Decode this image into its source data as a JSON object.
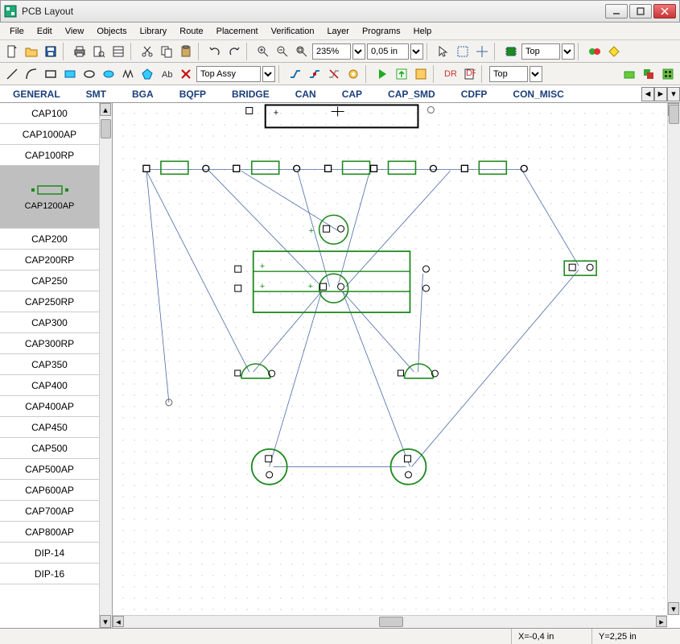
{
  "window": {
    "title": "PCB Layout"
  },
  "menu": [
    "File",
    "Edit",
    "View",
    "Objects",
    "Library",
    "Route",
    "Placement",
    "Verification",
    "Layer",
    "Programs",
    "Help"
  ],
  "toolbar1": {
    "zoom_value": "235%",
    "grid_value": "0,05 in",
    "layer_value": "Top"
  },
  "toolbar2": {
    "assy_value": "Top Assy",
    "layer_value": "Top"
  },
  "categories": [
    "GENERAL",
    "SMT",
    "BGA",
    "BQFP",
    "BRIDGE",
    "CAN",
    "CAP",
    "CAP_SMD",
    "CDFP",
    "CON_MISC"
  ],
  "sidebar": {
    "items": [
      "CAP100",
      "CAP1000AP",
      "CAP100RP",
      "",
      "CAP1200AP",
      "CAP200",
      "CAP200RP",
      "CAP250",
      "CAP250RP",
      "CAP300",
      "CAP300RP",
      "CAP350",
      "CAP400",
      "CAP400AP",
      "CAP450",
      "CAP500",
      "CAP500AP",
      "CAP600AP",
      "CAP700AP",
      "CAP800AP",
      "DIP-14",
      "DIP-16"
    ]
  },
  "status": {
    "x": "X=-0,4 in",
    "y": "Y=2,25 in"
  },
  "colors": {
    "accent": "#1e8a1e",
    "link": "#1a3d7a"
  }
}
